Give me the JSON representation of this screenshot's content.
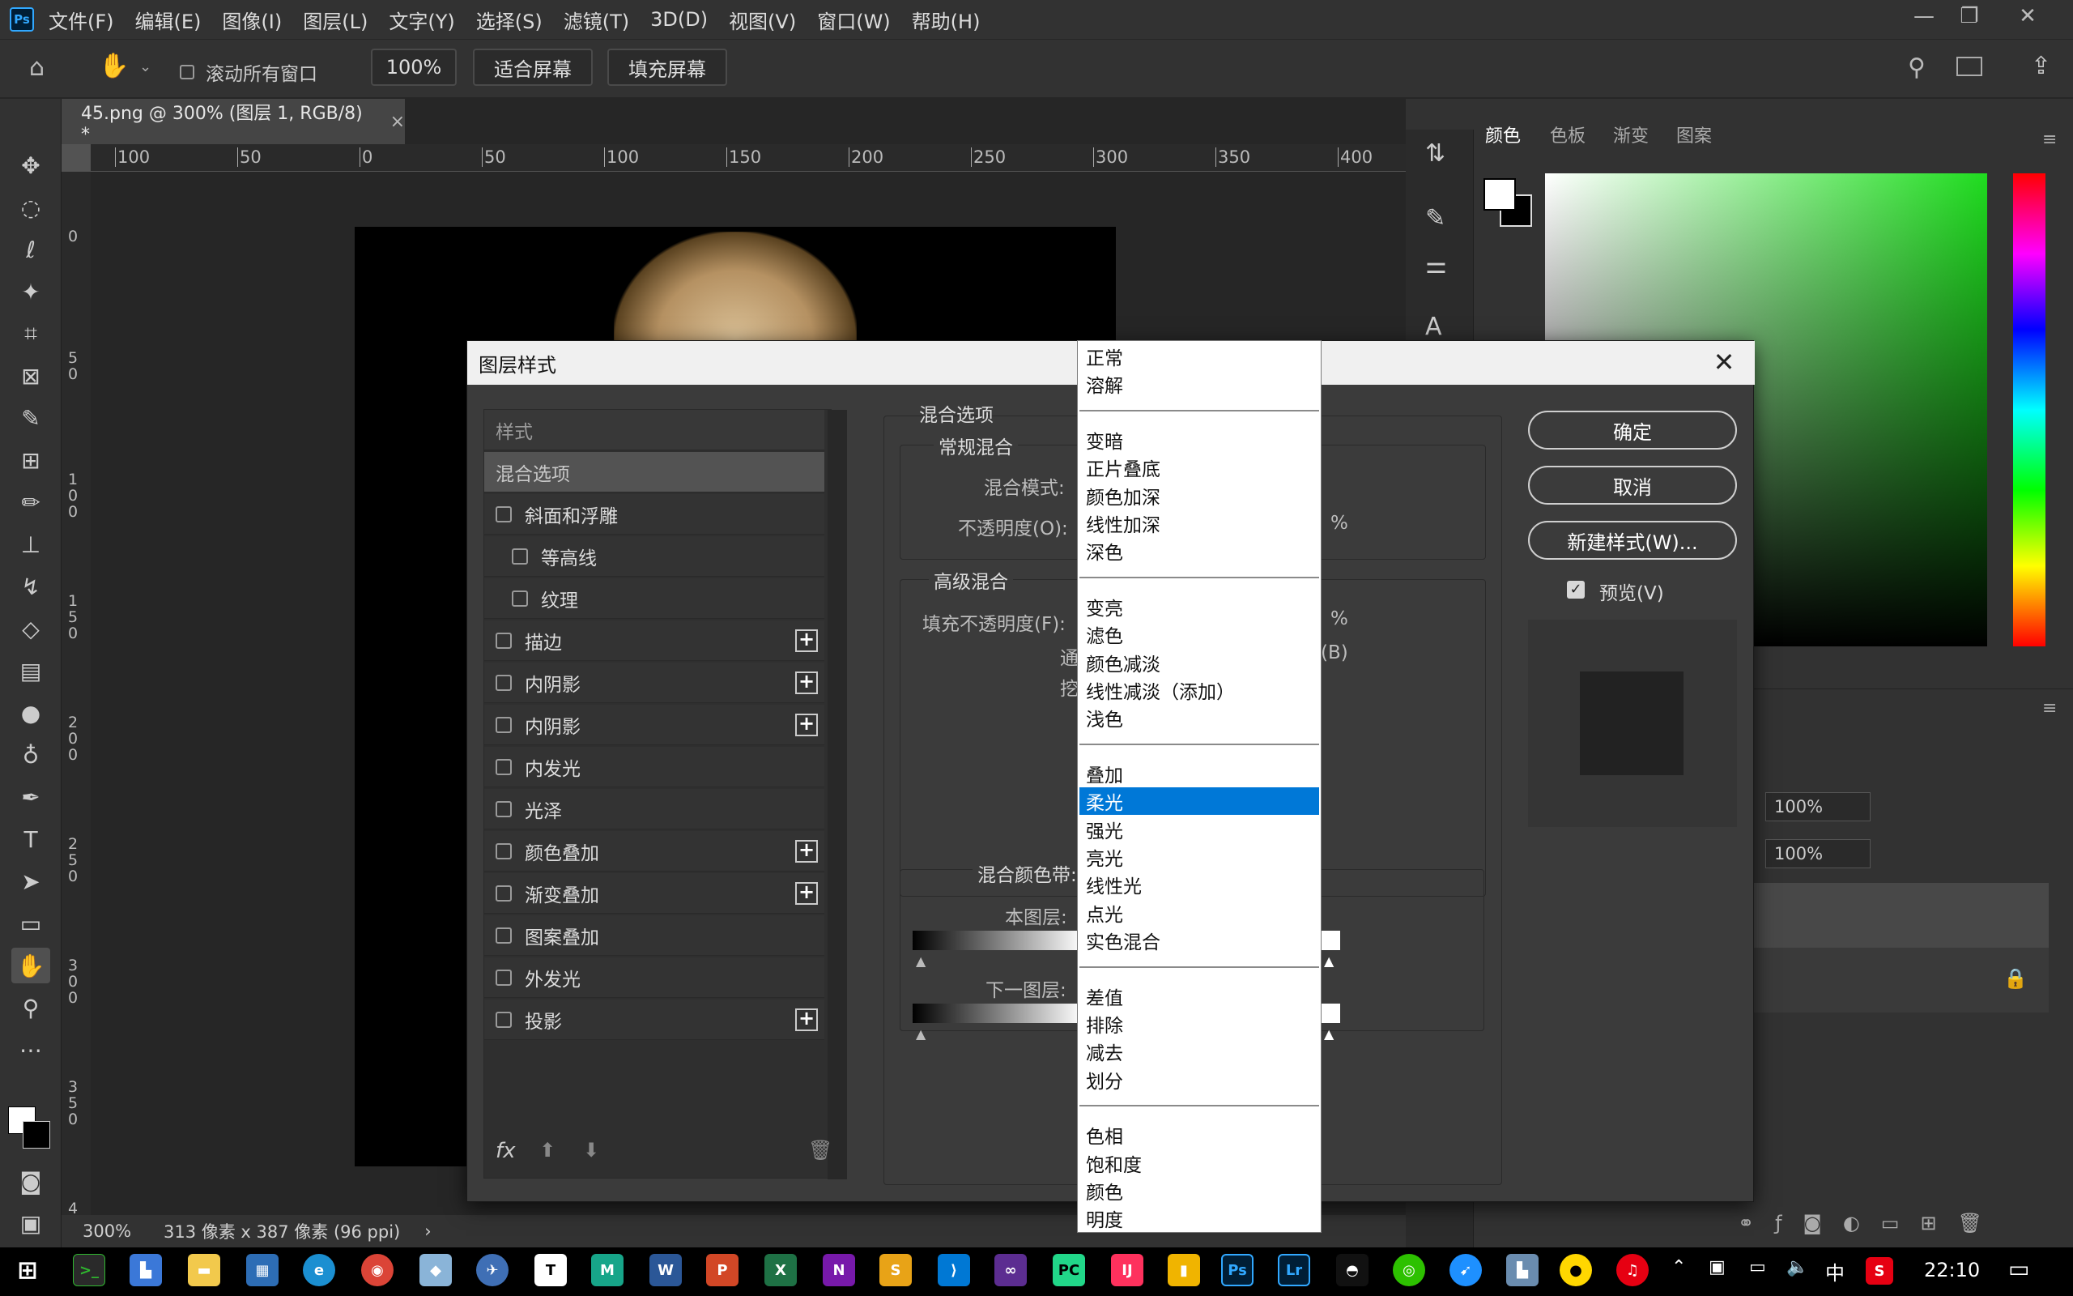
{
  "menubar": {
    "logo": "Ps",
    "items": [
      "文件(F)",
      "编辑(E)",
      "图像(I)",
      "图层(L)",
      "文字(Y)",
      "选择(S)",
      "滤镜(T)",
      "3D(D)",
      "视图(V)",
      "窗口(W)",
      "帮助(H)"
    ]
  },
  "options": {
    "scroll_all_label": "滚动所有窗口",
    "zoom_value": "100%",
    "fit_screen": "适合屏幕",
    "fill_screen": "填充屏幕"
  },
  "document": {
    "tab_title": "45.png @ 300% (图层 1, RGB/8) *",
    "ruler_top": [
      "100",
      "50",
      "0",
      "50",
      "100",
      "150",
      "200",
      "250",
      "300",
      "350",
      "400"
    ],
    "ruler_left": [
      "0",
      "5\n0",
      "1\n0\n0",
      "1\n5\n0",
      "2\n0\n0",
      "2\n5\n0",
      "3\n0\n0",
      "3\n5\n0",
      "4"
    ],
    "status_zoom": "300%",
    "status_info": "313 像素 x 387 像素 (96 ppi)"
  },
  "panels": {
    "tabs": [
      "颜色",
      "色板",
      "渐变",
      "图案"
    ],
    "fill_label": "100%",
    "opacity_label": "100%"
  },
  "dialog": {
    "title": "图层样式",
    "styles_header": "样式",
    "blend_options": "混合选项",
    "style_items": [
      {
        "label": "斜面和浮雕",
        "indent": false,
        "plus": false
      },
      {
        "label": "等高线",
        "indent": true,
        "plus": false
      },
      {
        "label": "纹理",
        "indent": true,
        "plus": false
      },
      {
        "label": "描边",
        "indent": false,
        "plus": true
      },
      {
        "label": "内阴影",
        "indent": false,
        "plus": true
      },
      {
        "label": "内阴影",
        "indent": false,
        "plus": true
      },
      {
        "label": "内发光",
        "indent": false,
        "plus": false
      },
      {
        "label": "光泽",
        "indent": false,
        "plus": false
      },
      {
        "label": "颜色叠加",
        "indent": false,
        "plus": true
      },
      {
        "label": "渐变叠加",
        "indent": false,
        "plus": true
      },
      {
        "label": "图案叠加",
        "indent": false,
        "plus": false
      },
      {
        "label": "外发光",
        "indent": false,
        "plus": false
      },
      {
        "label": "投影",
        "indent": false,
        "plus": true
      }
    ],
    "section_blend": "混合选项",
    "general_blend": "常规混合",
    "blend_mode_label": "混合模式:",
    "opacity_label": "不透明度(O):",
    "percent": "%",
    "advanced_blend": "高级混合",
    "fill_opacity_label": "填充不透明度(F):",
    "channels_label": "通道:",
    "channel_b": "(B)",
    "knockout_label": "挖空:",
    "blend_if_label": "混合颜色带:",
    "this_layer_label": "本图层:",
    "under_layer_label": "下一图层:",
    "ok": "确定",
    "cancel": "取消",
    "new_style": "新建样式(W)...",
    "preview": "预览(V)",
    "fx": "fx"
  },
  "dropdown": {
    "groups": [
      [
        "正常",
        "溶解"
      ],
      [
        "变暗",
        "正片叠底",
        "颜色加深",
        "线性加深",
        "深色"
      ],
      [
        "变亮",
        "滤色",
        "颜色减淡",
        "线性减淡（添加）",
        "浅色"
      ],
      [
        "叠加",
        "柔光",
        "强光",
        "亮光",
        "线性光",
        "点光",
        "实色混合"
      ],
      [
        "差值",
        "排除",
        "减去",
        "划分"
      ],
      [
        "色相",
        "饱和度",
        "颜色",
        "明度"
      ]
    ],
    "selected": "柔光"
  },
  "taskbar": {
    "time": "22:10",
    "ime": "中"
  },
  "colors": {
    "accent": "#0078d7",
    "ps_blue": "#31a8ff"
  }
}
